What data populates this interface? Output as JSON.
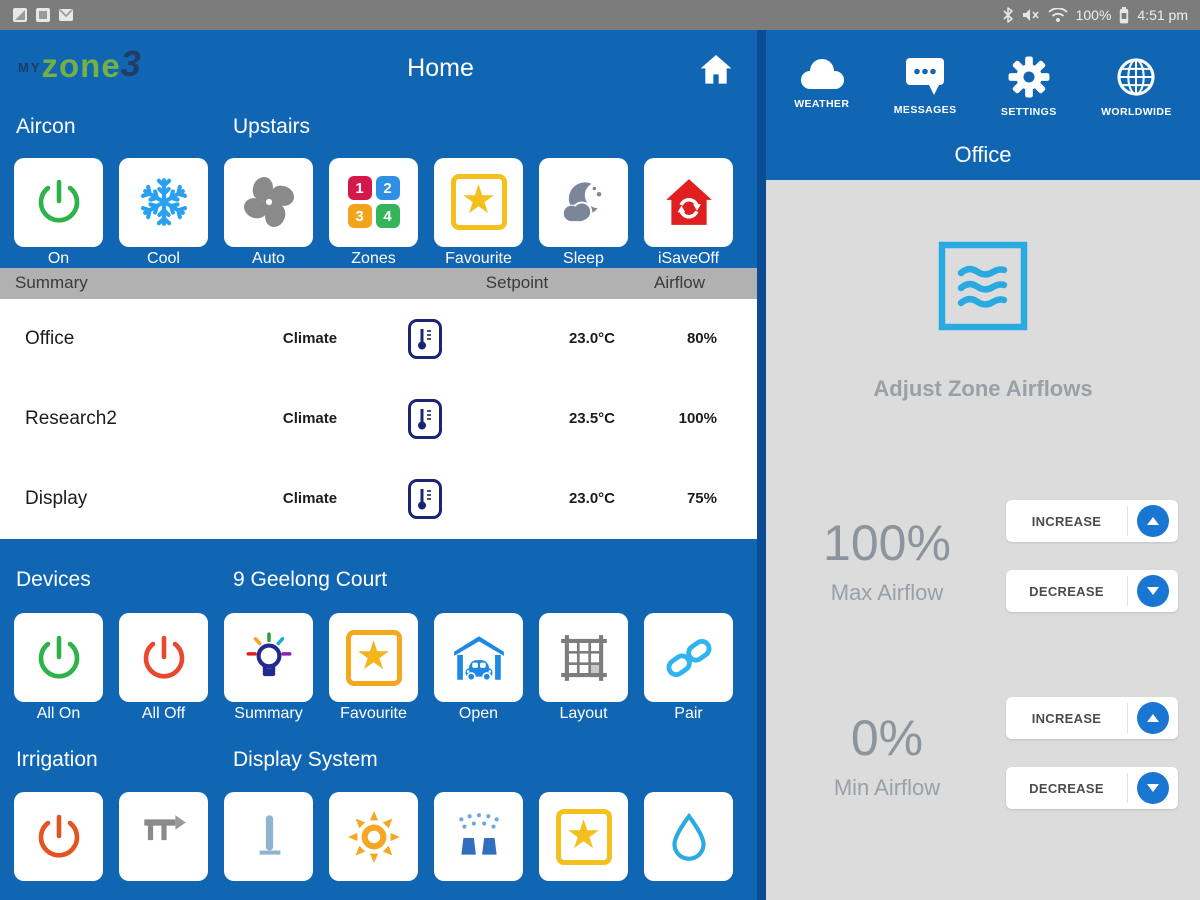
{
  "status_bar": {
    "time": "4:51 pm",
    "battery": "100%",
    "left_icons": [
      "screenshot-icon",
      "app-icon",
      "email-icon"
    ],
    "right_icons": [
      "bluetooth-icon",
      "mute-icon",
      "wifi-icon",
      "battery-icon"
    ]
  },
  "header": {
    "logo": {
      "my": "MY",
      "zone": "zone",
      "three": "3"
    },
    "title": "Home",
    "nav": [
      {
        "icon": "home-icon",
        "label": ""
      },
      {
        "icon": "weather-cloud-icon",
        "label": "WEATHER"
      },
      {
        "icon": "messages-icon",
        "label": "MESSAGES"
      },
      {
        "icon": "settings-gear-icon",
        "label": "SETTINGS"
      },
      {
        "icon": "worldwide-globe-icon",
        "label": "WORLDWIDE"
      }
    ]
  },
  "aircon": {
    "section_title": "Aircon",
    "section_subtitle": "Upstairs",
    "buttons": [
      {
        "label": "On",
        "icon": "power-icon-green"
      },
      {
        "label": "Cool",
        "icon": "snowflake-icon"
      },
      {
        "label": "Auto",
        "icon": "fan-icon"
      },
      {
        "label": "Zones",
        "icon": "zones-grid-icon",
        "zone_numbers": [
          "1",
          "2",
          "3",
          "4"
        ]
      },
      {
        "label": "Favourite",
        "icon": "star-icon"
      },
      {
        "label": "Sleep",
        "icon": "moon-cloud-icon"
      },
      {
        "label": "iSaveOff",
        "icon": "house-refresh-icon"
      }
    ],
    "table": {
      "header": {
        "summary": "Summary",
        "setpoint": "Setpoint",
        "airflow": "Airflow"
      },
      "rows": [
        {
          "zone": "Office",
          "mode": "Climate",
          "setpoint": "23.0°C",
          "airflow": "80%"
        },
        {
          "zone": "Research2",
          "mode": "Climate",
          "setpoint": "23.5°C",
          "airflow": "100%"
        },
        {
          "zone": "Display",
          "mode": "Climate",
          "setpoint": "23.0°C",
          "airflow": "75%"
        }
      ]
    }
  },
  "devices": {
    "section_title": "Devices",
    "section_subtitle": "9 Geelong Court",
    "buttons": [
      {
        "label": "All On",
        "icon": "power-icon-green"
      },
      {
        "label": "All Off",
        "icon": "power-icon-red"
      },
      {
        "label": "Summary",
        "icon": "lightbulb-icon"
      },
      {
        "label": "Favourite",
        "icon": "star-icon"
      },
      {
        "label": "Open",
        "icon": "garage-car-icon"
      },
      {
        "label": "Layout",
        "icon": "grid-icon"
      },
      {
        "label": "Pair",
        "icon": "chain-link-icon"
      }
    ]
  },
  "irrigation": {
    "section_title": "Irrigation",
    "section_subtitle": "Display System",
    "buttons": [
      {
        "icon": "power-icon-red"
      },
      {
        "icon": "pipe-icon"
      },
      {
        "icon": "sensor-icon"
      },
      {
        "icon": "sun-icon"
      },
      {
        "icon": "sprinkler-icon"
      },
      {
        "icon": "star-icon"
      },
      {
        "icon": "droplet-icon"
      }
    ]
  },
  "zone_panel": {
    "title": "Office",
    "subtitle": "Adjust Zone Airflows",
    "max": {
      "value": "100%",
      "label": "Max Airflow",
      "increase": "INCREASE",
      "decrease": "DECREASE"
    },
    "min": {
      "value": "0%",
      "label": "Min Airflow",
      "increase": "INCREASE",
      "decrease": "DECREASE"
    }
  },
  "colors": {
    "header_blue": "#1166b4",
    "divider_blue": "#0b4c94",
    "panel_gray": "#dcdcdc",
    "summary_bar_gray": "#b1b1b1",
    "accent_cyan": "#29abe2",
    "button_blue": "#1976d2",
    "power_green": "#2eb24a",
    "power_red": "#e8482e",
    "favourite_yellow": "#f3c01d",
    "isave_red": "#e02020"
  }
}
